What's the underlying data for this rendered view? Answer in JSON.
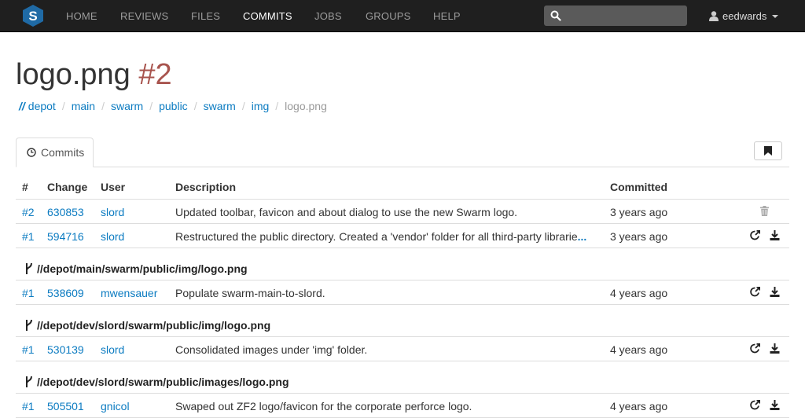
{
  "nav": {
    "items": [
      "HOME",
      "REVIEWS",
      "FILES",
      "COMMITS",
      "JOBS",
      "GROUPS",
      "HELP"
    ],
    "active": "COMMITS",
    "search_placeholder": "",
    "user": "eedwards"
  },
  "page": {
    "title": "logo.png",
    "revision": "#2"
  },
  "breadcrumb": {
    "root": "//",
    "items": [
      "depot",
      "main",
      "swarm",
      "public",
      "swarm",
      "img"
    ],
    "current": "logo.png"
  },
  "tab": {
    "label": "Commits"
  },
  "table": {
    "headers": {
      "num": "#",
      "change": "Change",
      "user": "User",
      "description": "Description",
      "committed": "Committed"
    },
    "top_rows": [
      {
        "num": "#2",
        "change": "630853",
        "user": "slord",
        "description": "Updated toolbar, favicon and about dialog to use the new Swarm logo.",
        "more": "",
        "committed": "3 years ago",
        "actions": [
          "trash-icon"
        ]
      },
      {
        "num": "#1",
        "change": "594716",
        "user": "slord",
        "description": "Restructured the public directory. Created a 'vendor' folder for all third-party librarie",
        "more": "...",
        "committed": "3 years ago",
        "actions": [
          "open-icon",
          "download-icon"
        ]
      }
    ],
    "groups": [
      {
        "path": "//depot/main/swarm/public/img/logo.png",
        "rows": [
          {
            "num": "#1",
            "change": "538609",
            "user": "mwensauer",
            "description": "Populate swarm-main-to-slord.",
            "committed": "4 years ago"
          }
        ]
      },
      {
        "path": "//depot/dev/slord/swarm/public/img/logo.png",
        "rows": [
          {
            "num": "#1",
            "change": "530139",
            "user": "slord",
            "description": "Consolidated images under 'img' folder.",
            "committed": "4 years ago"
          }
        ]
      },
      {
        "path": "//depot/dev/slord/swarm/public/images/logo.png",
        "rows": [
          {
            "num": "#1",
            "change": "505501",
            "user": "gnicol",
            "description": "Swaped out ZF2 logo/favicon for the corporate perforce logo.",
            "committed": "4 years ago"
          }
        ]
      }
    ]
  },
  "colors": {
    "navbar": "#1f1f1f",
    "link": "#0b7bc1",
    "revision": "#a8544e",
    "logo": "#1f6aa5"
  }
}
